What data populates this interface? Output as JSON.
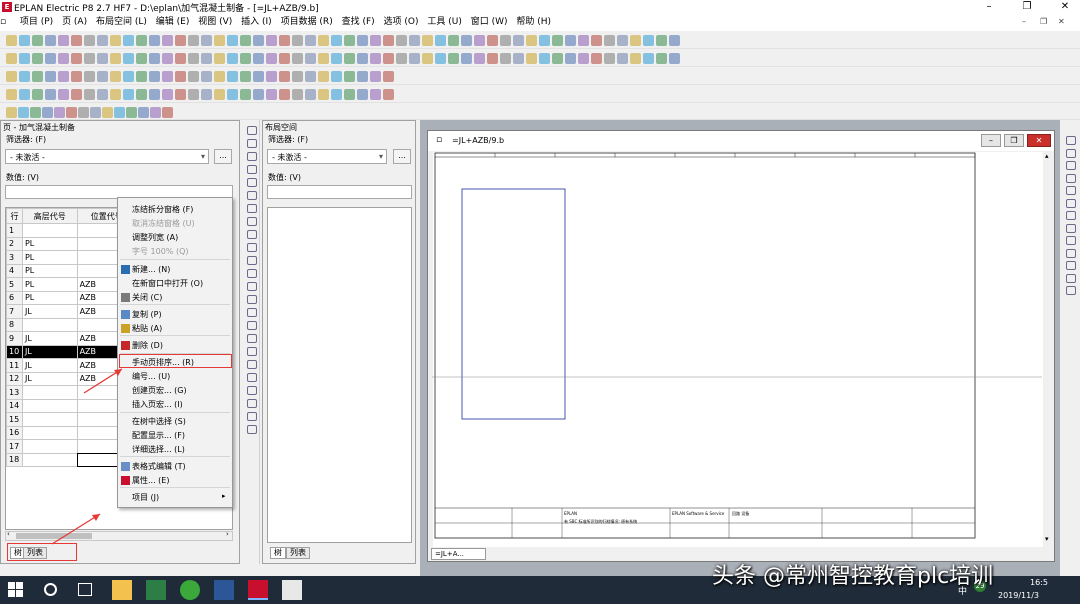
{
  "window": {
    "logo": "E",
    "title": "EPLAN Electric P8 2.7 HF7 - D:\\eplan\\加气混凝土制备 - [=JL+AZB/9.b]",
    "minimize": "–",
    "restore": "❐",
    "close": "✕"
  },
  "menu": [
    "项目 (P)",
    "页 (A)",
    "布局空间 (L)",
    "编辑 (E)",
    "视图 (V)",
    "插入 (I)",
    "项目数据 (R)",
    "查找 (F)",
    "选项 (O)",
    "工具 (U)",
    "窗口 (W)",
    "帮助 (H)"
  ],
  "page_nav": {
    "title": "页 - 加气混凝土制备",
    "filter_label": "筛选器: (F)",
    "filter_value": "- 未激活 -",
    "dots": "...",
    "value_label": "数值: (V)",
    "columns": [
      "行",
      "高层代号",
      "位置代号"
    ],
    "rows": [
      {
        "n": "1",
        "a": "",
        "b": ""
      },
      {
        "n": "2",
        "a": "PL",
        "b": ""
      },
      {
        "n": "3",
        "a": "PL",
        "b": ""
      },
      {
        "n": "4",
        "a": "PL",
        "b": ""
      },
      {
        "n": "5",
        "a": "PL",
        "b": "AZB"
      },
      {
        "n": "6",
        "a": "PL",
        "b": "AZB"
      },
      {
        "n": "7",
        "a": "JL",
        "b": "AZB"
      },
      {
        "n": "8",
        "a": "",
        "b": ""
      },
      {
        "n": "9",
        "a": "JL",
        "b": "AZB"
      },
      {
        "n": "10",
        "a": "JL",
        "b": "AZB"
      },
      {
        "n": "11",
        "a": "JL",
        "b": "AZB"
      },
      {
        "n": "12",
        "a": "JL",
        "b": "AZB"
      },
      {
        "n": "13",
        "a": "",
        "b": ""
      },
      {
        "n": "14",
        "a": "",
        "b": ""
      },
      {
        "n": "15",
        "a": "",
        "b": ""
      },
      {
        "n": "16",
        "a": "",
        "b": ""
      },
      {
        "n": "17",
        "a": "",
        "b": ""
      },
      {
        "n": "18",
        "a": "",
        "b": ""
      }
    ],
    "tab_tree": "树",
    "tab_list": "列表"
  },
  "context_menu": [
    {
      "label": "冻结拆分窗格 (F)",
      "disabled": false
    },
    {
      "label": "取消冻结窗格 (U)",
      "disabled": true
    },
    {
      "label": "调整列宽 (A)",
      "disabled": false
    },
    {
      "label": "字号 100% (Q)",
      "disabled": true
    },
    {
      "label": "新建... (N)",
      "disabled": false
    },
    {
      "label": "在新窗口中打开 (O)",
      "disabled": false
    },
    {
      "label": "关闭 (C)",
      "disabled": false
    },
    {
      "label": "复制 (P)",
      "disabled": false
    },
    {
      "label": "粘贴 (A)",
      "disabled": false
    },
    {
      "label": "删除 (D)",
      "disabled": false
    },
    {
      "label": "手动页排序... (R)",
      "disabled": false
    },
    {
      "label": "编号... (U)",
      "disabled": false
    },
    {
      "label": "创建页宏... (G)",
      "disabled": false
    },
    {
      "label": "插入页宏... (I)",
      "disabled": false
    },
    {
      "label": "在树中选择 (S)",
      "disabled": false
    },
    {
      "label": "配置显示... (F)",
      "disabled": false
    },
    {
      "label": "详细选择... (L)",
      "disabled": false
    },
    {
      "label": "表格式编辑 (T)",
      "disabled": false
    },
    {
      "label": "属性... (E)",
      "disabled": false
    },
    {
      "label": "项目 (J)",
      "disabled": false
    }
  ],
  "layout_space": {
    "title": "布局空间",
    "filter_label": "筛选器: (F)",
    "filter_value": "- 未激活 -",
    "dots": "...",
    "value_label": "数值: (V)",
    "tab_tree": "树",
    "tab_list": "列表"
  },
  "drawing": {
    "title": "=JL+AZB/9.b",
    "tab_label": "=JL+A...",
    "tb_c1": "EPLAN",
    "tb_c2": "EPLAN Software & Service",
    "tb_c3": "回路 设备",
    "tb_note": "有 SBC 标准所识别的归档情况: 原有系统"
  },
  "taskbar": {
    "time": "16:5",
    "date": "2019/11/3",
    "badge": "29",
    "ime": "中"
  },
  "watermark": "头条 @常州智控教育plc培训",
  "colors": {
    "accent": "#c8102e",
    "taskbar": "#1f2b38",
    "selection": "#000000",
    "annot": "#e53935"
  }
}
